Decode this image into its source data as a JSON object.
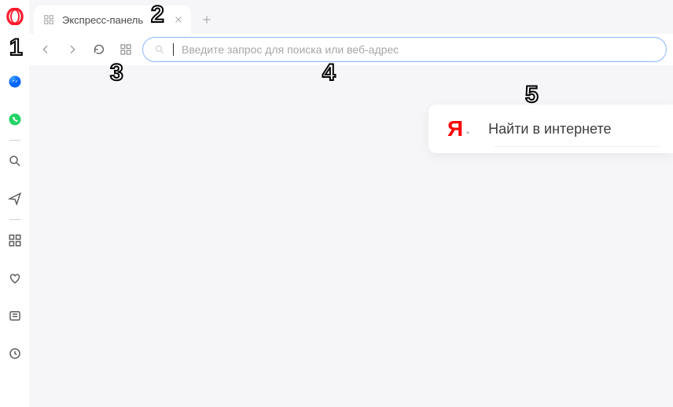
{
  "tab": {
    "title": "Экспресс-панель"
  },
  "omnibox": {
    "placeholder": "Введите запрос для поиска или веб-адрес"
  },
  "yandex_search": {
    "placeholder": "Найти в интернете",
    "logo_letter": "Я"
  },
  "annotations": {
    "n1": "1",
    "n2": "2",
    "n3": "3",
    "n4": "4",
    "n5": "5"
  }
}
